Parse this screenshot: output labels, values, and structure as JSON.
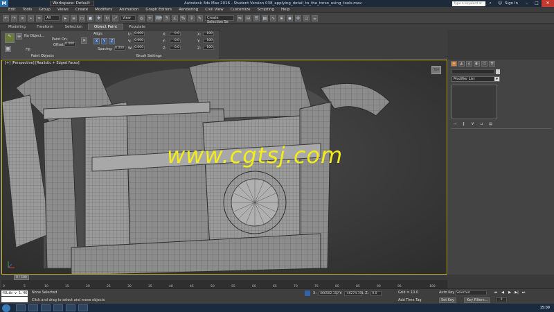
{
  "titlebar": {
    "workspace": "Workspace: Default",
    "app_title": "Autodesk 3ds Max 2016 - Student Version   038_applying_detail_to_the_torso_using_tools.max",
    "search_placeholder": "Type a keyword or phrase",
    "signin": "Sign In"
  },
  "menubar": [
    "Edit",
    "Tools",
    "Group",
    "Views",
    "Create",
    "Modifiers",
    "Animation",
    "Graph Editors",
    "Rendering",
    "Civil View",
    "Customize",
    "Scripting",
    "Help"
  ],
  "toolbar": {
    "filter": "All",
    "view": "View",
    "selection_set": "Create Selection Se"
  },
  "ribbon_tabs": [
    "Modeling",
    "Freeform",
    "Selection",
    "Object Paint",
    "Populate"
  ],
  "ribbon_active_tab": "Object Paint",
  "ribbon": {
    "no_object": "No Object...",
    "paint_on": "Paint On:",
    "offset": "Offset:",
    "offset_val": "0.000",
    "fill": "Fill",
    "align": "Align:",
    "spacing": "Spacing:",
    "spacing_val": "0.000",
    "u_label": "U:",
    "v_label": "V:",
    "w_label": "W:",
    "u_val": "0.000",
    "v_val": "0.000",
    "w_val": "0.000",
    "x_label": "X:",
    "y_label": "Y:",
    "z_label": "Z:",
    "x_val": "0.0",
    "y_val": "0.0",
    "z_val": "0.0",
    "sx_label": "X:",
    "sy_label": "Y:",
    "sz_label": "Z:",
    "sx_val": "100",
    "sy_val": "100",
    "sz_val": "100",
    "paint_objects": "Paint Objects",
    "brush_settings": "Brush Settings"
  },
  "viewport": {
    "label": "[+] [Perspective] [Realistic + Edged Faces]",
    "cube_label": "TOP"
  },
  "watermark": "www.cgtsj.com",
  "command_panel": {
    "modifier_list": "Modifier List"
  },
  "timeline": {
    "frame_display": "0 / 100",
    "ticks": [
      "0",
      "5",
      "10",
      "15",
      "20",
      "25",
      "30",
      "35",
      "40",
      "45",
      "50",
      "55",
      "60",
      "65",
      "70",
      "75",
      "80",
      "85",
      "90",
      "95",
      "100"
    ]
  },
  "status": {
    "maxscript": "Welcome to M",
    "listener": "fSLib v 1.46",
    "selection": "None Selected",
    "prompt": "Click and drag to select and move objects",
    "x_label": "X:",
    "x_val": "466502.157",
    "y_label": "Y:",
    "y_val": "-46274.191",
    "z_label": "Z:",
    "z_val": "0.0",
    "grid": "Grid = 10.0",
    "add_time_tag": "Add Time Tag",
    "auto_key": "Auto Key",
    "selected": "Selected",
    "set_key": "Set Key",
    "key_filters": "Key Filters...",
    "frame": "0"
  },
  "taskbar": {
    "clock": "15:09"
  },
  "colors": {
    "viewport_border": "#d4c23a",
    "watermark": "#f2ec1a",
    "active_cmd_tab": "#d5813a"
  }
}
